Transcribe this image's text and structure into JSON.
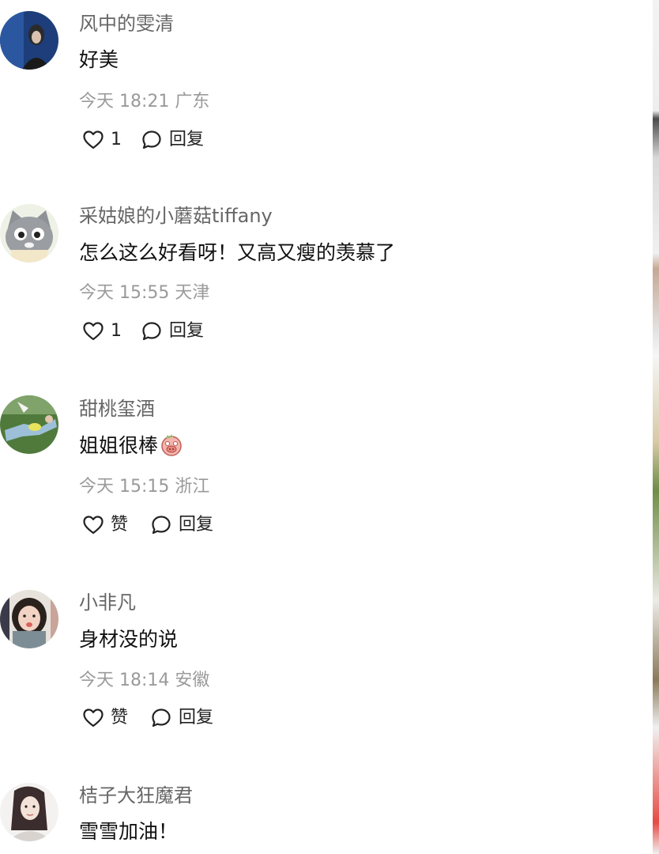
{
  "comments": [
    {
      "username": "风中的雯清",
      "content": "好美",
      "time": "今天 18:21",
      "location": "广东",
      "like_label": "1",
      "reply_label": "回复",
      "avatar_icon": "avatar-dark-blue-portrait"
    },
    {
      "username": "采姑娘的小蘑菇tiffany",
      "content": "怎么这么好看呀！又高又瘦的羡慕了",
      "time": "今天 15:55",
      "location": "天津",
      "like_label": "1",
      "reply_label": "回复",
      "avatar_icon": "avatar-gray-cat"
    },
    {
      "username": "甜桃玺酒",
      "content": "姐姐很棒",
      "content_emoji": "pig-face-emoji",
      "time": "今天 15:15",
      "location": "浙江",
      "like_label": "赞",
      "reply_label": "回复",
      "avatar_icon": "avatar-person-on-grass"
    },
    {
      "username": "小非凡",
      "content": "身材没的说",
      "time": "今天 18:14",
      "location": "安徽",
      "like_label": "赞",
      "reply_label": "回复",
      "avatar_icon": "avatar-girl-face"
    },
    {
      "username": "桔子大狂魔君",
      "content": "雪雪加油！",
      "avatar_icon": "avatar-anime-woman"
    }
  ],
  "colors": {
    "username": "#666666",
    "meta": "#9a9a9a",
    "content": "#111111",
    "icon_stroke": "#222222"
  }
}
